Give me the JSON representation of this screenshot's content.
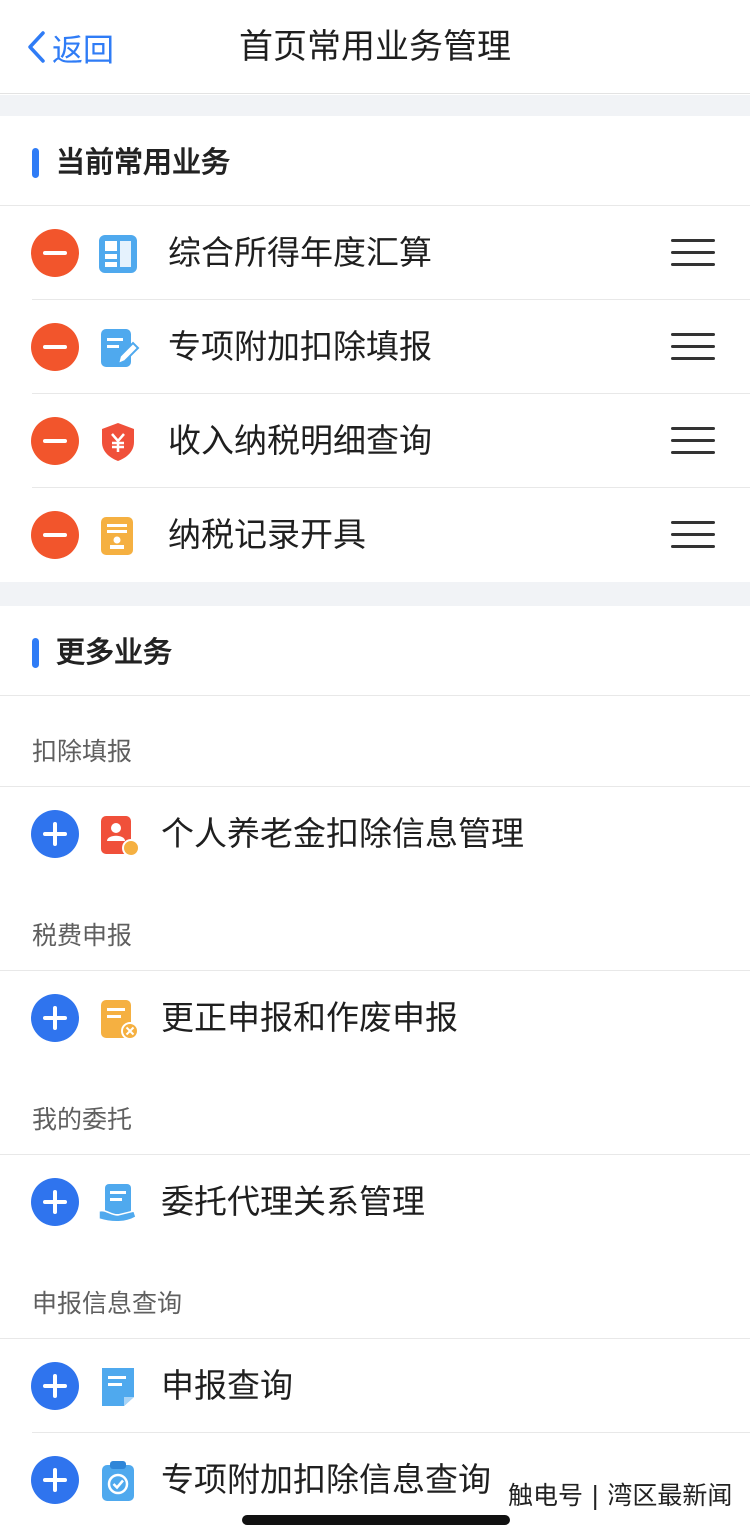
{
  "header": {
    "back_label": "返回",
    "title": "首页常用业务管理"
  },
  "current_section": {
    "title": "当前常用业务",
    "items": [
      {
        "label": "综合所得年度汇算",
        "icon": "grid-icon"
      },
      {
        "label": "专项附加扣除填报",
        "icon": "edit-document-icon"
      },
      {
        "label": "收入纳税明细查询",
        "icon": "yuan-shield-icon"
      },
      {
        "label": "纳税记录开具",
        "icon": "stamp-document-icon"
      }
    ]
  },
  "more_section": {
    "title": "更多业务",
    "groups": [
      {
        "title": "扣除填报",
        "items": [
          {
            "label": "个人养老金扣除信息管理",
            "icon": "pension-card-icon"
          }
        ]
      },
      {
        "title": "税费申报",
        "items": [
          {
            "label": "更正申报和作废申报",
            "icon": "document-cancel-icon"
          }
        ]
      },
      {
        "title": "我的委托",
        "items": [
          {
            "label": "委托代理关系管理",
            "icon": "hand-document-icon"
          }
        ]
      },
      {
        "title": "申报信息查询",
        "items": [
          {
            "label": "申报查询",
            "icon": "document-icon"
          },
          {
            "label": "专项附加扣除信息查询",
            "icon": "clipboard-check-icon"
          }
        ]
      }
    ]
  },
  "colors": {
    "accent": "#2f7cf6",
    "remove": "#f2552c",
    "add": "#2f74ee"
  },
  "watermark": "触电号 | 湾区最新闻"
}
